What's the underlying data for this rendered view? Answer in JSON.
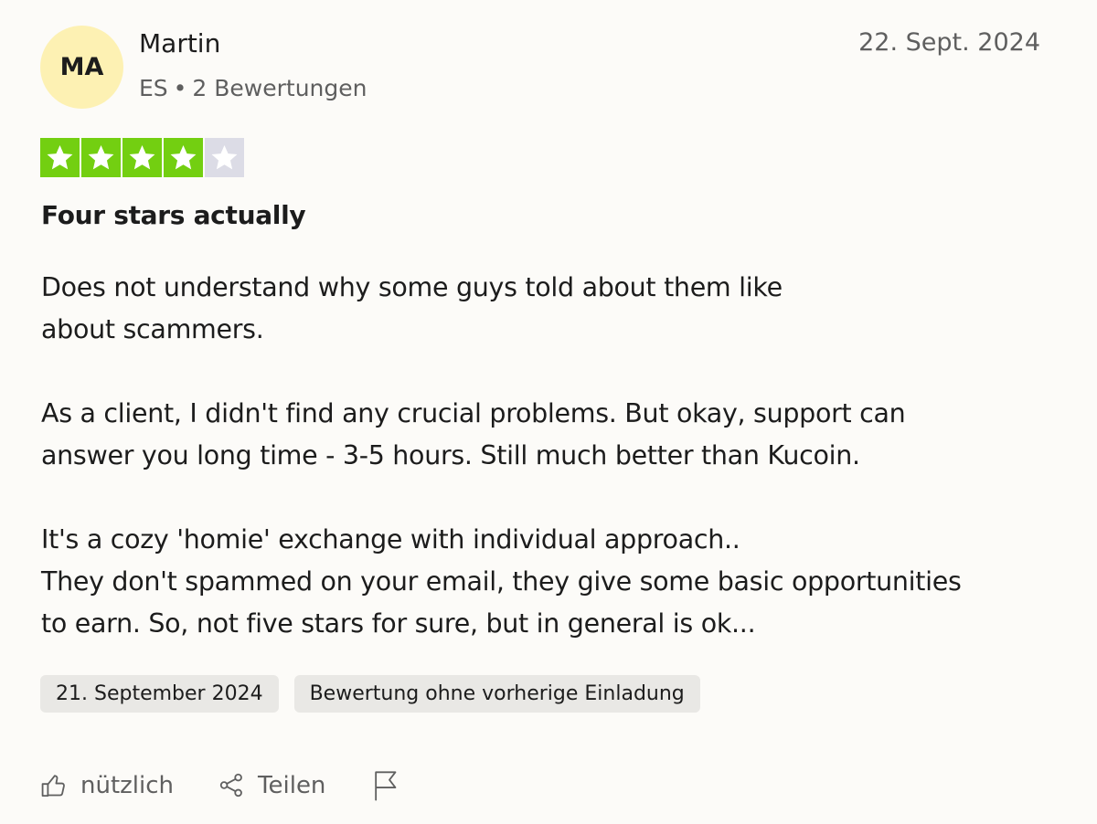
{
  "reviewer": {
    "initials": "MA",
    "avatar_color": "#fdf1b3",
    "name": "Martin",
    "country": "ES",
    "separator": "•",
    "review_count": "2 Bewertungen"
  },
  "review": {
    "date": "22. Sept. 2024",
    "rating": 4,
    "rating_max": 5,
    "star_color": "#73cf11",
    "star_empty_color": "#dcdce6",
    "title": "Four stars actually",
    "body": {
      "p1": [
        "Does not understand why some guys told about them like",
        "about scammers."
      ],
      "p2": [
        "As a client, I didn't find any crucial problems. But okay, support can",
        "answer you long time - 3-5 hours. Still much better than Kucoin."
      ],
      "p3": [
        "It's a cozy 'homie' exchange with individual approach..",
        "They don't spammed on your email, they give some basic opportunities",
        "to earn. So, not five stars for sure, but in general is ok..."
      ]
    },
    "experience_date": "21. September 2024",
    "invitation_label": "Bewertung ohne vorherige Einladung"
  },
  "actions": {
    "useful_icon": "thumbs-up-icon",
    "useful_label": "nützlich",
    "share_icon": "share-icon",
    "share_label": "Teilen",
    "report_icon": "flag-icon"
  }
}
